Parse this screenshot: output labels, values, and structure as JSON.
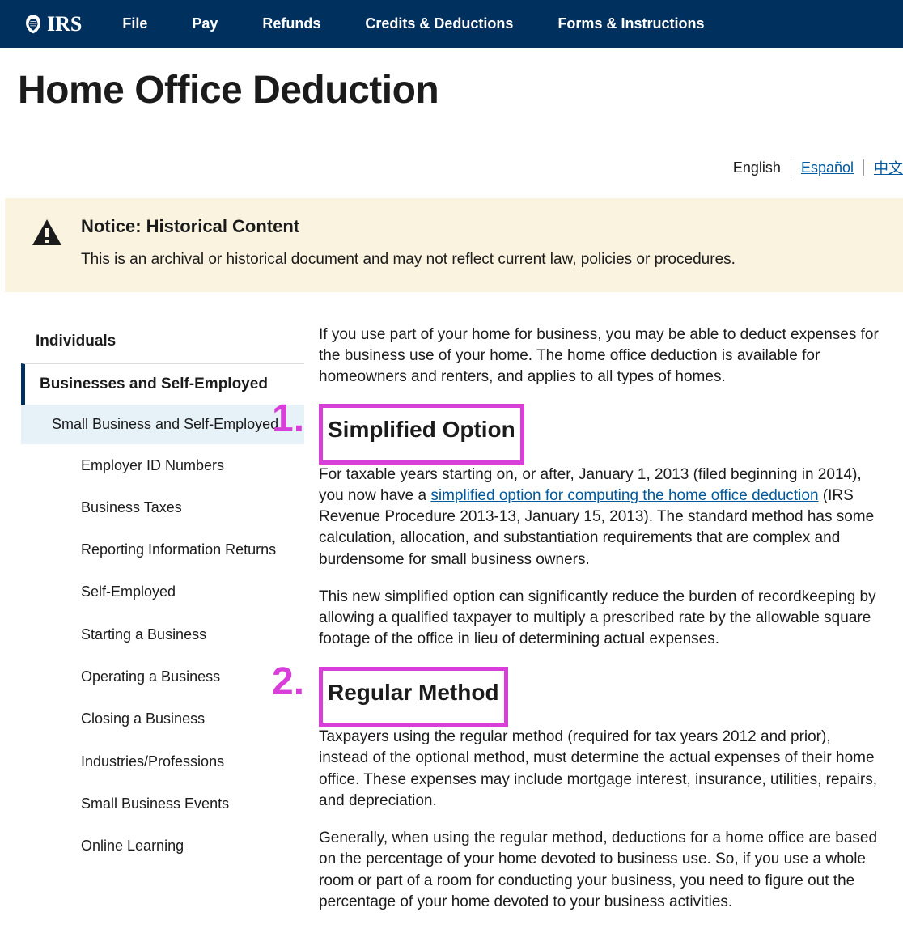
{
  "logo_text": "IRS",
  "nav": {
    "file": "File",
    "pay": "Pay",
    "refunds": "Refunds",
    "credits": "Credits & Deductions",
    "forms": "Forms & Instructions"
  },
  "page_title": "Home Office Deduction",
  "languages": {
    "english": "English",
    "espanol": "Español",
    "chinese": "中文"
  },
  "notice": {
    "title": "Notice: Historical Content",
    "body": "This is an archival or historical document and may not reflect current law, policies or procedures."
  },
  "sidebar": {
    "individuals": "Individuals",
    "section": "Businesses and Self-Employed",
    "active_sub": "Small Business and Self-Employed",
    "items": [
      "Employer ID Numbers",
      "Business Taxes",
      "Reporting Information Returns",
      "Self-Employed",
      "Starting a Business",
      "Operating a Business",
      "Closing a Business",
      "Industries/Professions",
      "Small Business Events",
      "Online Learning"
    ]
  },
  "article": {
    "intro": "If you use part of your home for business, you may be able to deduct expenses for the business use of your home. The home office deduction is available for homeowners and renters, and applies to all types of homes.",
    "h1": "Simplified Option",
    "p1_a": "For taxable years starting on, or after, January 1, 2013 (filed beginning in 2014), you now have a ",
    "p1_link": "simplified option for computing the home office deduction",
    "p1_b": " (IRS Revenue Procedure 2013-13, January 15, 2013). The standard method has some calculation, allocation, and substantiation requirements that are complex and burdensome for small business owners.",
    "p2": "This new simplified option can significantly reduce the burden of recordkeeping by allowing a qualified taxpayer to multiply a prescribed rate by the allowable square footage of the office in lieu of determining actual expenses.",
    "h2": "Regular Method",
    "p3": "Taxpayers using the regular method (required for tax years 2012 and prior), instead of the optional method, must determine the actual expenses of their home office. These expenses may include mortgage interest, insurance, utilities, repairs, and depreciation.",
    "p4": "Generally, when using the regular method, deductions for a home office are based on the percentage of your home devoted to business use. So, if you use a whole room or part of a room for conducting your business, you need to figure out the percentage of your home devoted to your business activities."
  },
  "annotations": {
    "one": "1.",
    "two": "2."
  }
}
